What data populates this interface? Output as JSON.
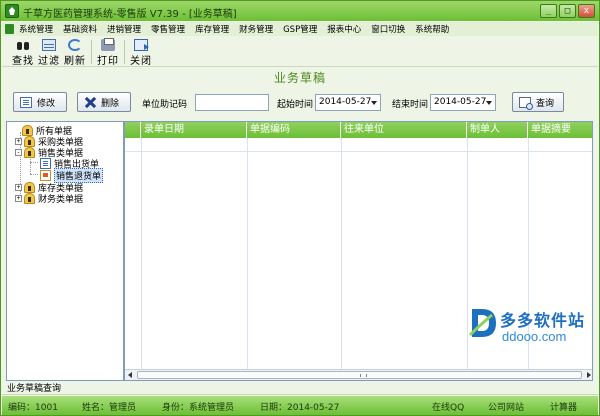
{
  "window": {
    "title": "千草方医药管理系统-零售版 V7.39 - [业务草稿]",
    "controls": [
      "_",
      "□",
      "x"
    ]
  },
  "menu": [
    "系统管理",
    "基础资料",
    "进销管理",
    "零售管理",
    "库存管理",
    "财务管理",
    "GSP管理",
    "报表中心",
    "窗口切换",
    "系统帮助"
  ],
  "toolbar": {
    "search": "查找",
    "filter": "过滤",
    "refresh": "刷新",
    "print": "打印",
    "close": "关闭"
  },
  "page": {
    "title": "业务草稿"
  },
  "filters": {
    "edit_label": "修改",
    "delete_label": "删除",
    "unit_code_label": "单位助记码",
    "unit_code_value": "",
    "start_time_label": "起始时间",
    "start_time_value": "2014-05-27",
    "end_time_label": "结束时间",
    "end_time_value": "2014-05-27",
    "query_label": "查询"
  },
  "tree": [
    {
      "label": "所有单据",
      "level": 0,
      "icon": "folder-icon"
    },
    {
      "label": "采购类单据",
      "level": 0,
      "icon": "folder-icon",
      "expander": "+"
    },
    {
      "label": "销售类单据",
      "level": 0,
      "icon": "folder-icon",
      "expander": "-"
    },
    {
      "label": "销售出货单",
      "level": 1,
      "icon": "document-icon"
    },
    {
      "label": "销售退货单",
      "level": 1,
      "icon": "return-document-icon",
      "selected": true
    },
    {
      "label": "库存类单据",
      "level": 0,
      "icon": "folder-icon",
      "expander": "+"
    },
    {
      "label": "财务类单据",
      "level": 0,
      "icon": "folder-icon",
      "expander": "+"
    }
  ],
  "grid": {
    "columns": [
      "录单日期",
      "单据编码",
      "往来单位",
      "制单人",
      "单据摘要"
    ],
    "rows": []
  },
  "watermark": {
    "cn": "多多软件站",
    "en": "ddooo.com"
  },
  "status": {
    "caption": "业务草稿查询",
    "code_label": "编码：",
    "code_value": "1001",
    "name_label": "姓名：",
    "name_value": "管理员",
    "role_label": "身份：",
    "role_value": "系统管理员",
    "date_label": "日期：",
    "date_value": "2014-05-27",
    "online_qq": "在线QQ",
    "company_site": "公司网站",
    "calculator": "计算器"
  },
  "colors": {
    "accent": "#6cbf34",
    "heading": "#4b8a1e",
    "watermark": "#1e6fc0"
  }
}
